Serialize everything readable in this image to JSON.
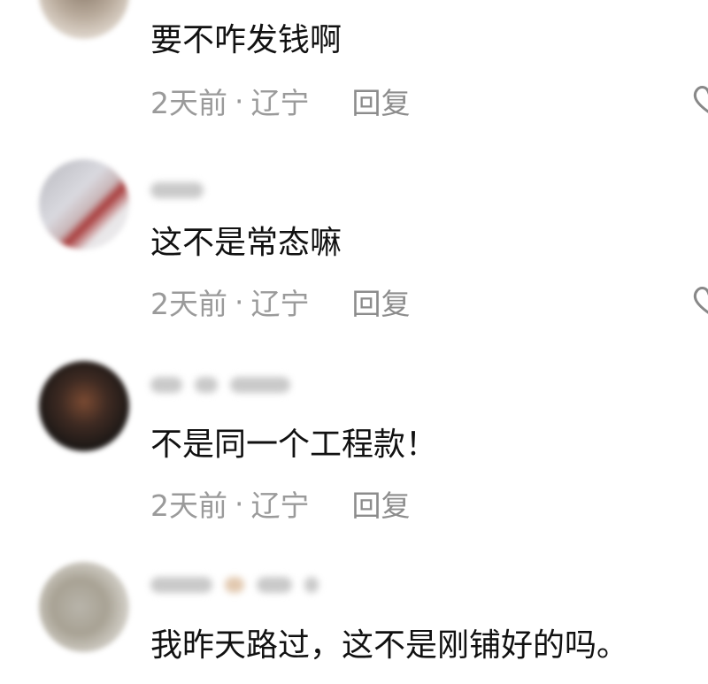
{
  "comments": [
    {
      "text": "要不咋发钱啊",
      "time": "2天前",
      "separator": "·",
      "location": "辽宁",
      "reply_label": "回复",
      "like_icon": "heart-outline-icon"
    },
    {
      "text": "这不是常态嘛",
      "time": "2天前",
      "separator": "·",
      "location": "辽宁",
      "reply_label": "回复",
      "like_icon": "heart-outline-icon"
    },
    {
      "text": "不是同一个工程款！",
      "time": "2天前",
      "separator": "·",
      "location": "辽宁",
      "reply_label": "回复"
    },
    {
      "text": "我昨天路过，这不是刚铺好的吗。"
    }
  ],
  "colors": {
    "text": "#111111",
    "meta": "#9a9a9a",
    "background": "#ffffff"
  }
}
